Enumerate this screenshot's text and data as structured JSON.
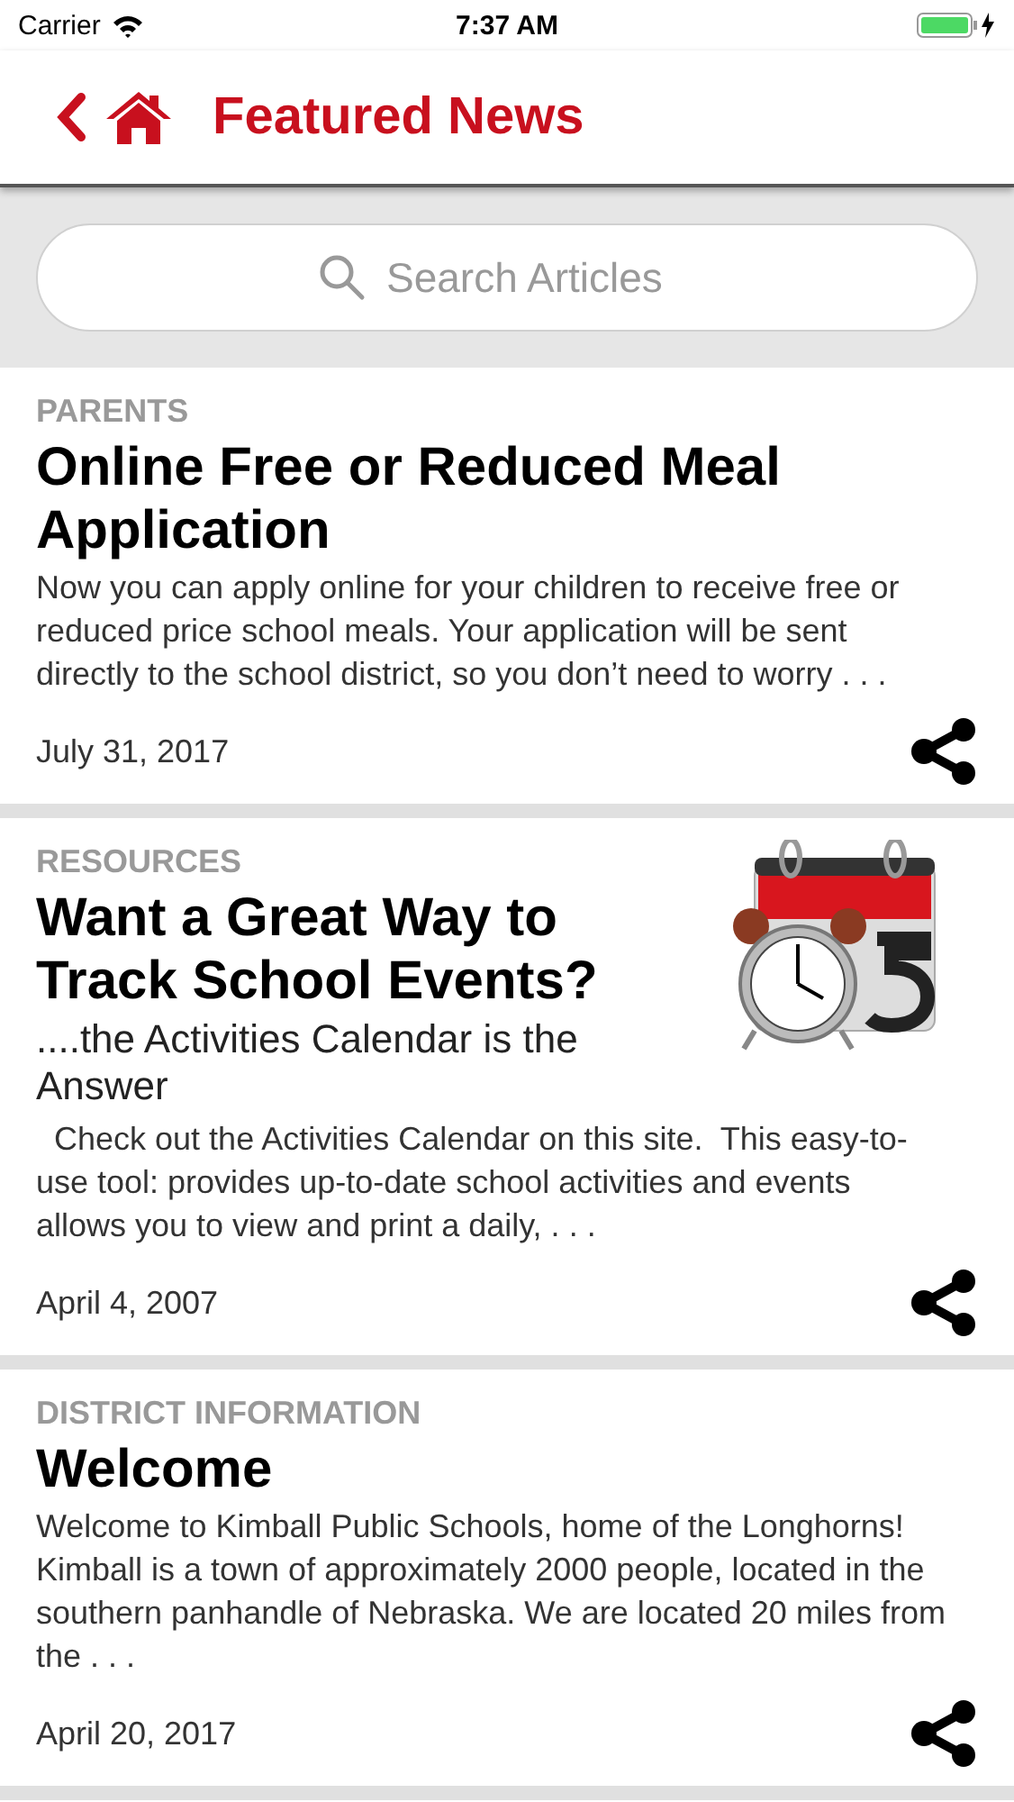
{
  "status_bar": {
    "carrier": "Carrier",
    "time": "7:37 AM"
  },
  "nav_bar": {
    "title": "Featured News"
  },
  "search": {
    "placeholder": "Search Articles"
  },
  "articles": [
    {
      "kind": "text",
      "category": "PARENTS",
      "title": "Online Free or Reduced Meal Application",
      "summary": "Now you can apply online for your children to receive free or reduced price school meals. Your application will be sent directly to the school district, so you don’t need to worry . . .",
      "date": "July 31, 2017"
    },
    {
      "kind": "image",
      "category": "RESOURCES",
      "title": "Want a Great Way to Track School Events?",
      "subtitle": "....the Activities Calendar is the Answer",
      "summary": "  Check out the Activities Calendar on this site.  This easy-to-use tool: provides up-to-date school activities and events allows you to view and print a daily, . . .",
      "date": "April 4, 2007"
    },
    {
      "kind": "text",
      "category": "DISTRICT INFORMATION",
      "title": "Welcome",
      "summary": "Welcome to Kimball Public Schools, home of the Longhorns! Kimball is a town of approximately 2000 people, located in the southern panhandle of Nebraska. We are located 20 miles from the . . .",
      "date": "April 20, 2017"
    }
  ]
}
